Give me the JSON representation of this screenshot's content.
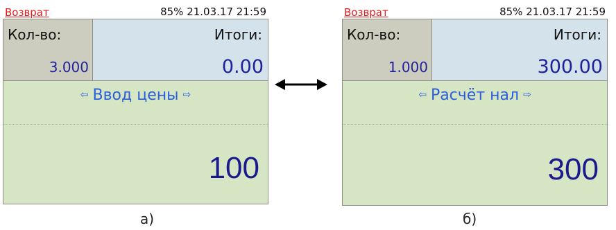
{
  "screens": [
    {
      "status_left": "Возврат",
      "status_right": "85% 21.03.17 21:59",
      "qty_label": "Кол-во:",
      "qty_value": "3.000",
      "totals_label": "Итоги:",
      "totals_value": "0.00",
      "mode_label": "Ввод цены",
      "input_value": "100"
    },
    {
      "status_left": "Возврат",
      "status_right": "85% 21.03.17 21:59",
      "qty_label": "Кол-во:",
      "qty_value": "1.000",
      "totals_label": "Итоги:",
      "totals_value": "300.00",
      "mode_label": "Расчёт нал",
      "input_value": "300"
    }
  ],
  "captions": [
    "а)",
    "б)"
  ],
  "mode_arrow_left": "⇦",
  "mode_arrow_right": "⇨",
  "colors": {
    "status_red": "#e21a1a",
    "qty_bg": "#ccccbf",
    "totals_bg": "#d4e2ec",
    "input_bg": "#d6e6c5",
    "value_blue": "#1a1a8c",
    "mode_blue": "#2b5fd9"
  }
}
